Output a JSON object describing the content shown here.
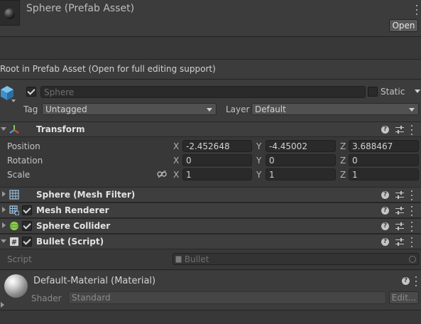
{
  "header": {
    "title": "Sphere (Prefab Asset)",
    "open_button": "Open"
  },
  "info": {
    "text": "Root in Prefab Asset (Open for full editing support)"
  },
  "gameobject": {
    "active": true,
    "name": "Sphere",
    "static_label": "Static",
    "static_checked": false,
    "tag_label": "Tag",
    "tag_value": "Untagged",
    "layer_label": "Layer",
    "layer_value": "Default"
  },
  "transform": {
    "title": "Transform",
    "rows": [
      {
        "label": "Position",
        "x": "-2.452648",
        "y": "-4.45002",
        "z": "3.688467"
      },
      {
        "label": "Rotation",
        "x": "0",
        "y": "0",
        "z": "0"
      },
      {
        "label": "Scale",
        "x": "1",
        "y": "1",
        "z": "1"
      }
    ],
    "axes": {
      "x": "X",
      "y": "Y",
      "z": "Z"
    }
  },
  "components": [
    {
      "title": "Sphere (Mesh Filter)",
      "has_checkbox": false,
      "icon": "grid-icon"
    },
    {
      "title": "Mesh Renderer",
      "has_checkbox": true,
      "icon": "mesh-renderer-icon"
    },
    {
      "title": "Sphere Collider",
      "has_checkbox": true,
      "icon": "sphere-collider-icon"
    },
    {
      "title": "Bullet (Script)",
      "has_checkbox": true,
      "icon": "script-icon"
    }
  ],
  "script": {
    "label": "Script",
    "value": "Bullet"
  },
  "material": {
    "title": "Default-Material (Material)",
    "shader_label": "Shader",
    "shader_value": "Standard",
    "edit_button": "Edit..."
  },
  "colors": {
    "background": "#383838",
    "header": "#3c3c3c",
    "field": "#2a2a2a",
    "accent_cube": "#4aa3e0",
    "collider_green": "#8fd14f"
  }
}
